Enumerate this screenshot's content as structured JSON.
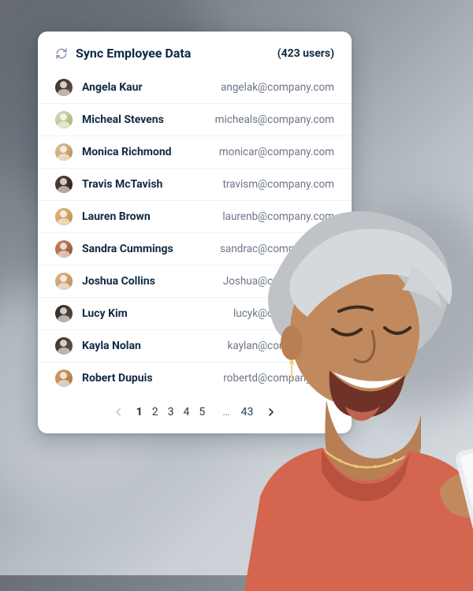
{
  "panel": {
    "title": "Sync Employee Data",
    "user_count": "(423 users)"
  },
  "employees": [
    {
      "name": "Angela Kaur",
      "email": "angelak@company.com",
      "c1": "#3a2f2a",
      "c2": "#6a5144"
    },
    {
      "name": "Micheal Stevens",
      "email": "micheals@company.com",
      "c1": "#d9e3b8",
      "c2": "#a0b072"
    },
    {
      "name": "Monica Richmond",
      "email": "monicar@company.com",
      "c1": "#e5c69a",
      "c2": "#b88a55"
    },
    {
      "name": "Travis McTavish",
      "email": "travism@company.com",
      "c1": "#5d4132",
      "c2": "#2e1e15"
    },
    {
      "name": "Lauren Brown",
      "email": "laurenb@company.com",
      "c1": "#e7bb7e",
      "c2": "#c18a4d"
    },
    {
      "name": "Sandra Cummings",
      "email": "sandrac@company.com",
      "c1": "#c9885d",
      "c2": "#8b5433"
    },
    {
      "name": "Joshua Collins",
      "email": "Joshua@company.com",
      "c1": "#e0b98e",
      "c2": "#b98954"
    },
    {
      "name": "Lucy Kim",
      "email": "lucyk@company.com",
      "c1": "#2b2623",
      "c2": "#5a4c42"
    },
    {
      "name": "Kayla Nolan",
      "email": "kaylan@company.com",
      "c1": "#3b3028",
      "c2": "#6b5646"
    },
    {
      "name": "Robert Dupuis",
      "email": "robertd@company.com",
      "c1": "#d7a46d",
      "c2": "#a37242"
    }
  ],
  "pagination": {
    "pages": [
      "1",
      "2",
      "3",
      "4",
      "5"
    ],
    "ellipsis": "…",
    "last": "43",
    "current": 0
  }
}
